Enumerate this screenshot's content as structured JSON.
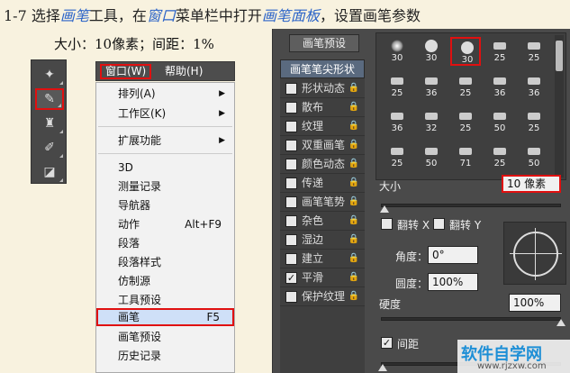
{
  "header": {
    "p1": "1-7 选择",
    "h1": "画笔",
    "p2": "工具，在",
    "h2": "窗口",
    "p3": "菜单栏中打开",
    "h3": "画笔面板",
    "p4": "，设置画笔参数"
  },
  "subheader": "大小：10像素；间距：1%",
  "toolbar": {
    "tools": [
      {
        "icon": "spot-healing-icon",
        "glyph": "✦"
      },
      {
        "icon": "brush-icon",
        "glyph": "✎",
        "active": true
      },
      {
        "icon": "stamp-icon",
        "glyph": "♜"
      },
      {
        "icon": "history-brush-icon",
        "glyph": "✐"
      },
      {
        "icon": "eraser-icon",
        "glyph": "◪"
      }
    ]
  },
  "menubar": {
    "window_label": "窗口(W)",
    "help_label": "帮助(H)"
  },
  "window_menu": {
    "items": [
      {
        "label": "排列(A)",
        "shortcut": "",
        "submenu": true
      },
      {
        "label": "工作区(K)",
        "shortcut": "",
        "submenu": true
      },
      {
        "label": "扩展功能",
        "shortcut": "",
        "submenu": true
      },
      {
        "label": "3D",
        "shortcut": ""
      },
      {
        "label": "测量记录",
        "shortcut": ""
      },
      {
        "label": "导航器",
        "shortcut": ""
      },
      {
        "label": "动作",
        "shortcut": "Alt+F9"
      },
      {
        "label": "段落",
        "shortcut": ""
      },
      {
        "label": "段落样式",
        "shortcut": ""
      },
      {
        "label": "仿制源",
        "shortcut": ""
      },
      {
        "label": "工具预设",
        "shortcut": ""
      },
      {
        "label": "画笔",
        "shortcut": "F5",
        "selected": true
      },
      {
        "label": "画笔预设",
        "shortcut": ""
      },
      {
        "label": "历史记录",
        "shortcut": ""
      }
    ]
  },
  "brush_panel": {
    "preset_button": "画笔预设",
    "tip_shape_header": "画笔笔尖形状",
    "options": [
      {
        "label": "形状动态",
        "checked": false
      },
      {
        "label": "散布",
        "checked": false
      },
      {
        "label": "纹理",
        "checked": false
      },
      {
        "label": "双重画笔",
        "checked": false
      },
      {
        "label": "颜色动态",
        "checked": false
      },
      {
        "label": "传递",
        "checked": false
      },
      {
        "label": "画笔笔势",
        "checked": false
      },
      {
        "label": "杂色",
        "checked": false
      },
      {
        "label": "湿边",
        "checked": false
      },
      {
        "label": "建立",
        "checked": false
      },
      {
        "label": "平滑",
        "checked": true
      },
      {
        "label": "保护纹理",
        "checked": false
      }
    ],
    "tips": [
      {
        "size": "30",
        "kind": "soft"
      },
      {
        "size": "30",
        "kind": "hard"
      },
      {
        "size": "30",
        "kind": "hard",
        "selected": true
      },
      {
        "size": "25",
        "kind": "stroke"
      },
      {
        "size": "25",
        "kind": "stroke"
      },
      {
        "size": "25",
        "kind": "stroke"
      },
      {
        "size": "36",
        "kind": "stroke"
      },
      {
        "size": "25",
        "kind": "stroke"
      },
      {
        "size": "36",
        "kind": "stroke"
      },
      {
        "size": "36",
        "kind": "stroke"
      },
      {
        "size": "36",
        "kind": "stroke"
      },
      {
        "size": "32",
        "kind": "stroke"
      },
      {
        "size": "25",
        "kind": "stroke"
      },
      {
        "size": "50",
        "kind": "stroke"
      },
      {
        "size": "25",
        "kind": "stroke"
      },
      {
        "size": "25",
        "kind": "stroke"
      },
      {
        "size": "50",
        "kind": "stroke"
      },
      {
        "size": "71",
        "kind": "stroke"
      },
      {
        "size": "25",
        "kind": "stroke"
      },
      {
        "size": "50",
        "kind": "stroke"
      }
    ],
    "size_label": "大小",
    "size_value": "10 像素",
    "size_fraction": 0.02,
    "flip_x_label": "翻转 X",
    "flip_y_label": "翻转 Y",
    "angle_label": "角度：",
    "angle_value": "0°",
    "roundness_label": "圆度：",
    "roundness_value": "100%",
    "hardness_label": "硬度",
    "hardness_value": "100%",
    "hardness_fraction": 1.0,
    "spacing_label": "间距",
    "spacing_checked": true,
    "spacing_fraction": 0.01
  },
  "watermark": {
    "title": "软件自学网",
    "url": "www.rjzxw.com"
  },
  "colors": {
    "highlight": "#e01010",
    "accent_text": "#2a63c8"
  }
}
